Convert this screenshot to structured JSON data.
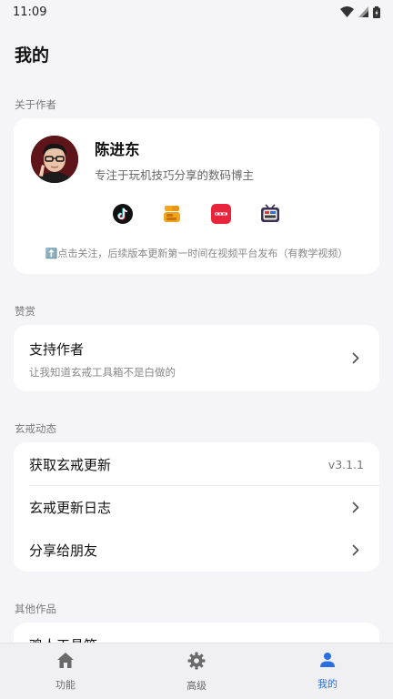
{
  "status_bar": {
    "time": "11:09"
  },
  "page": {
    "title": "我的"
  },
  "sections": {
    "about": "关于作者",
    "donate": "赞赏",
    "updates": "玄戒动态",
    "other": "其他作品"
  },
  "author": {
    "name": "陈进东",
    "description": "专注于玩机技巧分享的数码博主",
    "note": "⬆️点击关注，后续版本更新第一时间在视频平台发布（有教学视频）",
    "social": [
      "tiktok-icon",
      "kuaishou-icon",
      "xiaohongshu-icon",
      "bilibili-icon"
    ]
  },
  "support": {
    "title": "支持作者",
    "subtitle": "让我知道玄戒工具箱不是白做的"
  },
  "updates": {
    "get_update": "获取玄戒更新",
    "version": "v3.1.1",
    "changelog": "玄戒更新日志",
    "share": "分享给朋友"
  },
  "other": {
    "first_item": "鸡人工具箱"
  },
  "nav": {
    "features": "功能",
    "advanced": "高级",
    "mine": "我的"
  },
  "colors": {
    "accent": "#2a6fe0",
    "background": "#f5f5f7",
    "card": "#ffffff"
  }
}
